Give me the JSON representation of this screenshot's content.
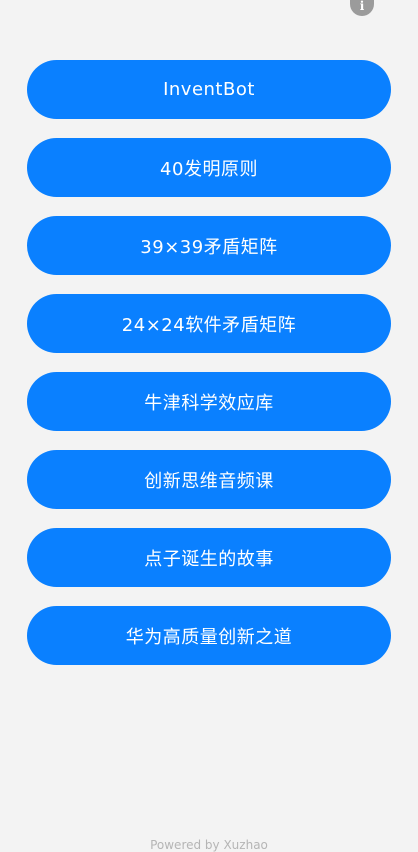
{
  "header": {
    "info_glyph": "i",
    "info_icon": "info-icon"
  },
  "menu": {
    "items": [
      "InventBot",
      "40发明原则",
      "39×39矛盾矩阵",
      "24×24软件矛盾矩阵",
      "牛津科学效应库",
      "创新思维音频课",
      "点子诞生的故事",
      "华为高质量创新之道"
    ]
  },
  "footer": {
    "text": "Powered by Xuzhao"
  },
  "colors": {
    "accent": "#0a80ff",
    "background": "#f3f3f3",
    "icon_gray": "#9b9b9b"
  }
}
